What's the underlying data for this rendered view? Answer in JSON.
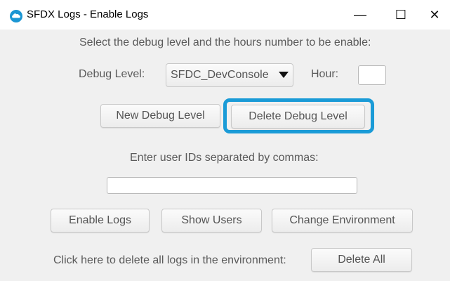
{
  "window": {
    "title": "SFDX Logs - Enable Logs",
    "icon": "salesforce-cloud-icon",
    "minimize_glyph": "—",
    "maximize_glyph": "☐",
    "close_glyph": "✕"
  },
  "instructions": {
    "select_prompt": "Select the debug level and the hours number to be enable:",
    "user_ids_prompt": "Enter user IDs separated by commas:",
    "delete_all_prompt": "Click here to delete all logs in the environment:"
  },
  "debug_level": {
    "label": "Debug Level:",
    "selected": "SFDC_DevConsole"
  },
  "hour": {
    "label": "Hour:",
    "value": ""
  },
  "user_ids": {
    "value": ""
  },
  "buttons": {
    "new_debug_level": "New Debug Level",
    "delete_debug_level": "Delete Debug Level",
    "enable_logs": "Enable Logs",
    "show_users": "Show Users",
    "change_environment": "Change Environment",
    "delete_all": "Delete All"
  },
  "colors": {
    "highlight": "#1a9bd7",
    "window_bg": "#f0f0f0",
    "icon": "#1b96d3"
  }
}
